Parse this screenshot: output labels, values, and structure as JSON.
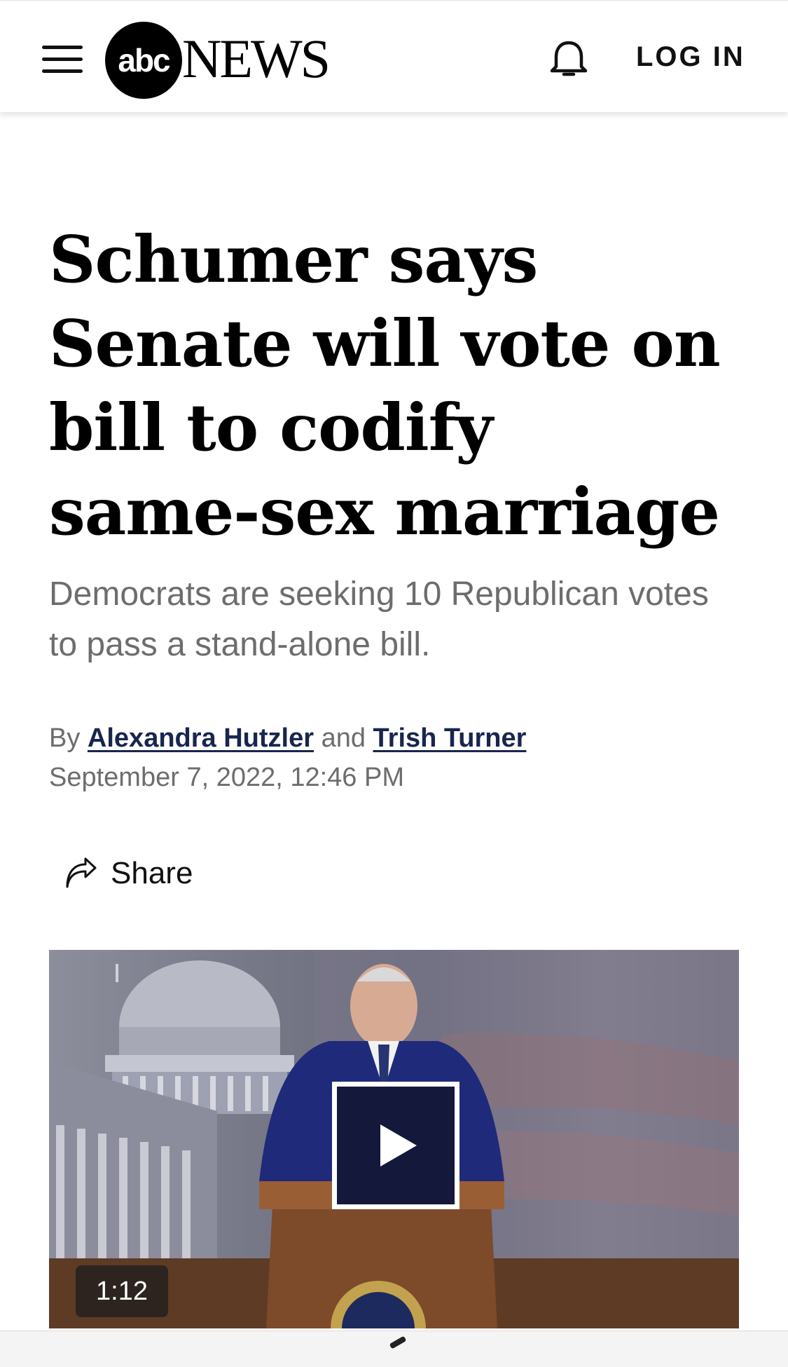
{
  "header": {
    "logo_badge": "abc",
    "logo_word": "NEWS",
    "login_label": "LOG IN",
    "icons": [
      "menu-icon",
      "bell-icon"
    ]
  },
  "article": {
    "headline": "Schumer says Senate will vote on bill to codify same-sex marriage",
    "subhead": "Democrats are seeking 10 Republican votes to pass a stand-alone bill.",
    "byline_prefix": "By",
    "author1": "Alexandra Hutzler",
    "byline_joiner": "and",
    "author2": "Trish Turner",
    "date": "September 7, 2022, 12:46 PM",
    "share_label": "Share"
  },
  "video": {
    "duration": "1:12"
  }
}
